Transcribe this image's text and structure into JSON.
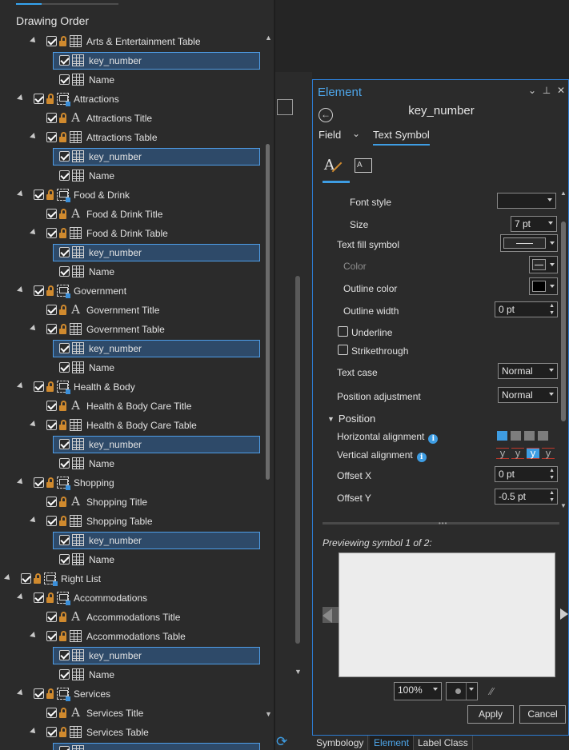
{
  "drawing_order": {
    "title": "Drawing Order",
    "rows": [
      {
        "depth": 3,
        "expand": true,
        "lock": true,
        "icon": "table",
        "label": "Arts & Entertainment Table",
        "selected": false
      },
      {
        "depth": 4,
        "expand": false,
        "lock": false,
        "icon": "table",
        "label": "key_number",
        "selected": true
      },
      {
        "depth": 4,
        "expand": false,
        "lock": false,
        "icon": "table",
        "label": "Name",
        "selected": false
      },
      {
        "depth": 2,
        "expand": true,
        "lock": true,
        "icon": "group",
        "label": "Attractions",
        "selected": false
      },
      {
        "depth": 3,
        "expand": false,
        "lock": true,
        "icon": "text",
        "label": "Attractions Title",
        "selected": false
      },
      {
        "depth": 3,
        "expand": true,
        "lock": true,
        "icon": "table",
        "label": "Attractions Table",
        "selected": false
      },
      {
        "depth": 4,
        "expand": false,
        "lock": false,
        "icon": "table",
        "label": "key_number",
        "selected": true
      },
      {
        "depth": 4,
        "expand": false,
        "lock": false,
        "icon": "table",
        "label": "Name",
        "selected": false
      },
      {
        "depth": 2,
        "expand": true,
        "lock": true,
        "icon": "group",
        "label": "Food & Drink",
        "selected": false
      },
      {
        "depth": 3,
        "expand": false,
        "lock": true,
        "icon": "text",
        "label": "Food & Drink Title",
        "selected": false
      },
      {
        "depth": 3,
        "expand": true,
        "lock": true,
        "icon": "table",
        "label": "Food & Drink Table",
        "selected": false
      },
      {
        "depth": 4,
        "expand": false,
        "lock": false,
        "icon": "table",
        "label": "key_number",
        "selected": true
      },
      {
        "depth": 4,
        "expand": false,
        "lock": false,
        "icon": "table",
        "label": "Name",
        "selected": false
      },
      {
        "depth": 2,
        "expand": true,
        "lock": true,
        "icon": "group",
        "label": "Government",
        "selected": false
      },
      {
        "depth": 3,
        "expand": false,
        "lock": true,
        "icon": "text",
        "label": "Government Title",
        "selected": false
      },
      {
        "depth": 3,
        "expand": true,
        "lock": true,
        "icon": "table",
        "label": "Government Table",
        "selected": false
      },
      {
        "depth": 4,
        "expand": false,
        "lock": false,
        "icon": "table",
        "label": "key_number",
        "selected": true
      },
      {
        "depth": 4,
        "expand": false,
        "lock": false,
        "icon": "table",
        "label": "Name",
        "selected": false
      },
      {
        "depth": 2,
        "expand": true,
        "lock": true,
        "icon": "group",
        "label": "Health & Body",
        "selected": false
      },
      {
        "depth": 3,
        "expand": false,
        "lock": true,
        "icon": "text",
        "label": "Health & Body Care Title",
        "selected": false
      },
      {
        "depth": 3,
        "expand": true,
        "lock": true,
        "icon": "table",
        "label": "Health & Body Care Table",
        "selected": false
      },
      {
        "depth": 4,
        "expand": false,
        "lock": false,
        "icon": "table",
        "label": "key_number",
        "selected": true
      },
      {
        "depth": 4,
        "expand": false,
        "lock": false,
        "icon": "table",
        "label": "Name",
        "selected": false
      },
      {
        "depth": 2,
        "expand": true,
        "lock": true,
        "icon": "group",
        "label": "Shopping",
        "selected": false
      },
      {
        "depth": 3,
        "expand": false,
        "lock": true,
        "icon": "text",
        "label": "Shopping Title",
        "selected": false
      },
      {
        "depth": 3,
        "expand": true,
        "lock": true,
        "icon": "table",
        "label": "Shopping Table",
        "selected": false
      },
      {
        "depth": 4,
        "expand": false,
        "lock": false,
        "icon": "table",
        "label": "key_number",
        "selected": true
      },
      {
        "depth": 4,
        "expand": false,
        "lock": false,
        "icon": "table",
        "label": "Name",
        "selected": false
      },
      {
        "depth": 1,
        "expand": true,
        "lock": true,
        "icon": "group",
        "label": "Right List",
        "selected": false
      },
      {
        "depth": 2,
        "expand": true,
        "lock": true,
        "icon": "group",
        "label": "Accommodations",
        "selected": false
      },
      {
        "depth": 3,
        "expand": false,
        "lock": true,
        "icon": "text",
        "label": "Accommodations Title",
        "selected": false
      },
      {
        "depth": 3,
        "expand": true,
        "lock": true,
        "icon": "table",
        "label": "Accommodations Table",
        "selected": false
      },
      {
        "depth": 4,
        "expand": false,
        "lock": false,
        "icon": "table",
        "label": "key_number",
        "selected": true
      },
      {
        "depth": 4,
        "expand": false,
        "lock": false,
        "icon": "table",
        "label": "Name",
        "selected": false
      },
      {
        "depth": 2,
        "expand": true,
        "lock": true,
        "icon": "group",
        "label": "Services",
        "selected": false
      },
      {
        "depth": 3,
        "expand": false,
        "lock": true,
        "icon": "text",
        "label": "Services Title",
        "selected": false
      },
      {
        "depth": 3,
        "expand": true,
        "lock": true,
        "icon": "table",
        "label": "Services Table",
        "selected": false
      },
      {
        "depth": 4,
        "expand": false,
        "lock": false,
        "icon": "table",
        "label": "",
        "selected": true
      }
    ]
  },
  "element_pane": {
    "title": "Element",
    "element_name": "key_number",
    "tab_field": "Field",
    "tab_text_symbol": "Text Symbol",
    "icons": [
      "text-symbol-icon",
      "text-box-icon"
    ],
    "props": {
      "font_style_label": "Font style",
      "font_style_value": "",
      "size_label": "Size",
      "size_value": "7 pt",
      "text_fill_label": "Text fill symbol",
      "color_label": "Color",
      "outline_color_label": "Outline color",
      "outline_width_label": "Outline width",
      "outline_width_value": "0 pt",
      "underline_label": "Underline",
      "strikethrough_label": "Strikethrough",
      "text_case_label": "Text case",
      "text_case_value": "Normal",
      "position_adj_label": "Position adjustment",
      "position_adj_value": "Normal",
      "position_section": "Position",
      "h_align_label": "Horizontal alignment",
      "v_align_label": "Vertical alignment",
      "offset_x_label": "Offset X",
      "offset_x_value": "0 pt",
      "offset_y_label": "Offset Y",
      "offset_y_value": "-0.5 pt"
    },
    "preview_label": "Previewing symbol 1 of 2:",
    "zoom_value": "100%",
    "apply_label": "Apply",
    "cancel_label": "Cancel"
  },
  "bottom_tabs": [
    "Symbology",
    "Element",
    "Label Class"
  ],
  "colors": {
    "accent": "#3e9de3",
    "selection_fill": "#2e4a69",
    "selection_border": "#4f9ee8",
    "lock": "#d08a2e"
  }
}
